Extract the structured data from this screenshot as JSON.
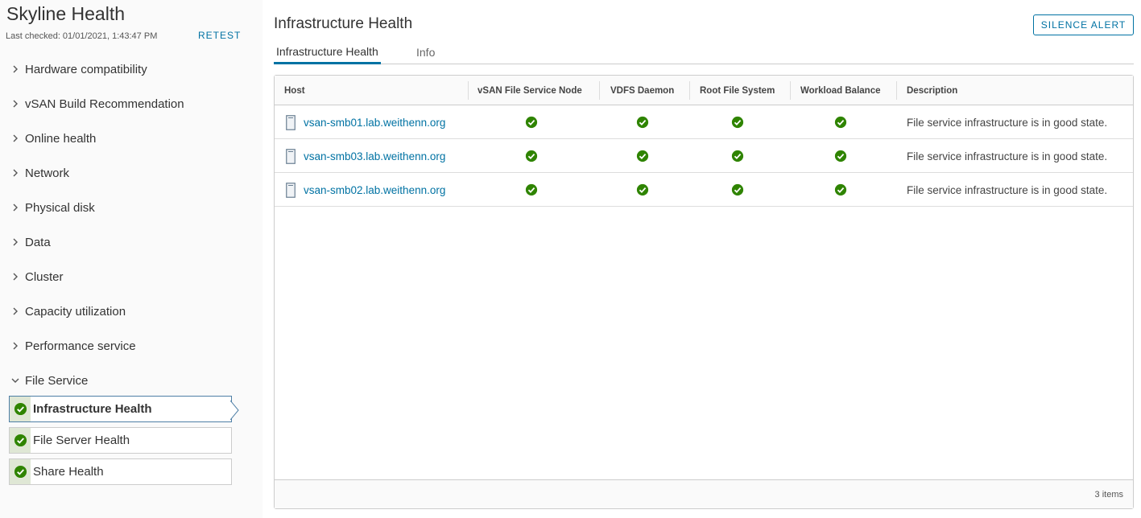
{
  "sidebar": {
    "title": "Skyline Health",
    "last_checked": "Last checked: 01/01/2021, 1:43:47 PM",
    "retest_label": "RETEST",
    "categories": [
      {
        "label": "Hardware compatibility",
        "expanded": false
      },
      {
        "label": "vSAN Build Recommendation",
        "expanded": false
      },
      {
        "label": "Online health",
        "expanded": false
      },
      {
        "label": "Network",
        "expanded": false
      },
      {
        "label": "Physical disk",
        "expanded": false
      },
      {
        "label": "Data",
        "expanded": false
      },
      {
        "label": "Cluster",
        "expanded": false
      },
      {
        "label": "Capacity utilization",
        "expanded": false
      },
      {
        "label": "Performance service",
        "expanded": false
      },
      {
        "label": "File Service",
        "expanded": true
      }
    ],
    "file_service_items": [
      {
        "label": "Infrastructure Health",
        "status": "ok",
        "selected": true
      },
      {
        "label": "File Server Health",
        "status": "ok",
        "selected": false
      },
      {
        "label": "Share Health",
        "status": "ok",
        "selected": false
      }
    ]
  },
  "main": {
    "title": "Infrastructure Health",
    "silence_label": "SILENCE ALERT",
    "tabs": [
      {
        "label": "Infrastructure Health",
        "active": true
      },
      {
        "label": "Info",
        "active": false
      }
    ],
    "grid": {
      "columns": [
        "Host",
        "vSAN File Service Node",
        "VDFS Daemon",
        "Root File System",
        "Workload Balance",
        "Description"
      ],
      "rows": [
        {
          "host": "vsan-smb01.lab.weithenn.org",
          "node": "ok",
          "vdfs": "ok",
          "rootfs": "ok",
          "balance": "ok",
          "description": "File service infrastructure is in good state."
        },
        {
          "host": "vsan-smb03.lab.weithenn.org",
          "node": "ok",
          "vdfs": "ok",
          "rootfs": "ok",
          "balance": "ok",
          "description": "File service infrastructure is in good state."
        },
        {
          "host": "vsan-smb02.lab.weithenn.org",
          "node": "ok",
          "vdfs": "ok",
          "rootfs": "ok",
          "balance": "ok",
          "description": "File service infrastructure is in good state."
        }
      ],
      "footer_count": "3 items"
    }
  },
  "icons": {
    "status_ok": "check-circle-icon",
    "host": "host-server-icon",
    "collapsed": "chevron-right-icon",
    "expanded": "chevron-down-icon"
  },
  "colors": {
    "accent": "#0072a3",
    "ok_green": "#2f8400",
    "status_stripe": "#dfe7d5"
  }
}
